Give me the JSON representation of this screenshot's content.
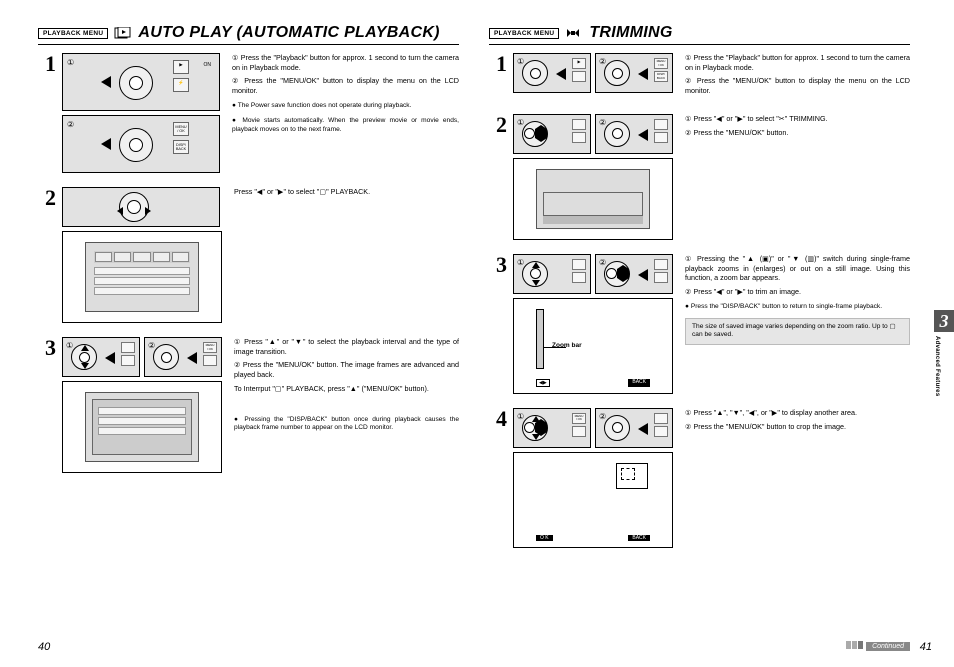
{
  "left_page": {
    "badge": "PLAYBACK MENU",
    "title": "AUTO PLAY (AUTOMATIC PLAYBACK)",
    "page_number": "40",
    "step1": {
      "num": "1",
      "line1": "① Press the \"Playback\" button for approx. 1 second to turn the camera on in Playback mode.",
      "line2": "② Press the \"MENU/OK\" button to display the menu on the LCD monitor.",
      "note1": "● The Power save function does not operate during playback.",
      "note2": "● Movie starts automatically. When the preview movie or movie ends, playback moves on to the next frame."
    },
    "step2": {
      "num": "2",
      "text": "Press \"◀\" or \"▶\" to select \"▢\" PLAYBACK."
    },
    "step3": {
      "num": "3",
      "line1": "① Press \"▲\" or \"▼\" to select the playback interval and the type of image transition.",
      "line2": "② Press the \"MENU/OK\" button. The image frames are advanced and played back.",
      "line3": "To Interrput \"▢\" PLAYBACK, press \"▲\" (\"MENU/OK\" button).",
      "note": "● Pressing the \"DISP/BACK\" button once during playback causes the playback frame number to appear on the LCD monitor."
    }
  },
  "right_page": {
    "badge": "PLAYBACK MENU",
    "title": "TRIMMING",
    "page_number": "41",
    "continued": "Continued",
    "step1": {
      "num": "1",
      "line1": "① Press the \"Playback\" button for approx. 1 second to turn the camera on in Playback mode.",
      "line2": "② Press the \"MENU/OK\" button to display the menu on the LCD monitor."
    },
    "step2": {
      "num": "2",
      "line1": "① Press \"◀\" or \"▶\" to select \"✂\" TRIMMING.",
      "line2": "② Press the \"MENU/OK\" button."
    },
    "step3": {
      "num": "3",
      "line1": "① Pressing the \"▲ (▣)\" or \"▼ (▥)\" switch during single-frame playback zooms in (enlarges) or out on a still image. Using this function, a zoom bar appears.",
      "line2": "② Press \"◀\" or \"▶\" to trim an image.",
      "note": "● Press the \"DISP/BACK\" button to return to single-frame playback.",
      "callout": "The size of saved image varies depending on the zoom ratio. Up to ▢ can be saved.",
      "zoom_label": "Zoom bar"
    },
    "step4": {
      "num": "4",
      "line1": "① Press \"▲\", \"▼\", \"◀\", or \"▶\" to display another area.",
      "line2": "② Press the \"MENU/OK\" button to crop the image.",
      "ok": "O K",
      "back": "BACK"
    }
  },
  "side_tab": {
    "num": "3",
    "label": "Advanced Features"
  },
  "ui_labels": {
    "menu_ok": "MENU\n/ OK",
    "disp_back": "DISP/\nBACK",
    "on": "ON"
  }
}
